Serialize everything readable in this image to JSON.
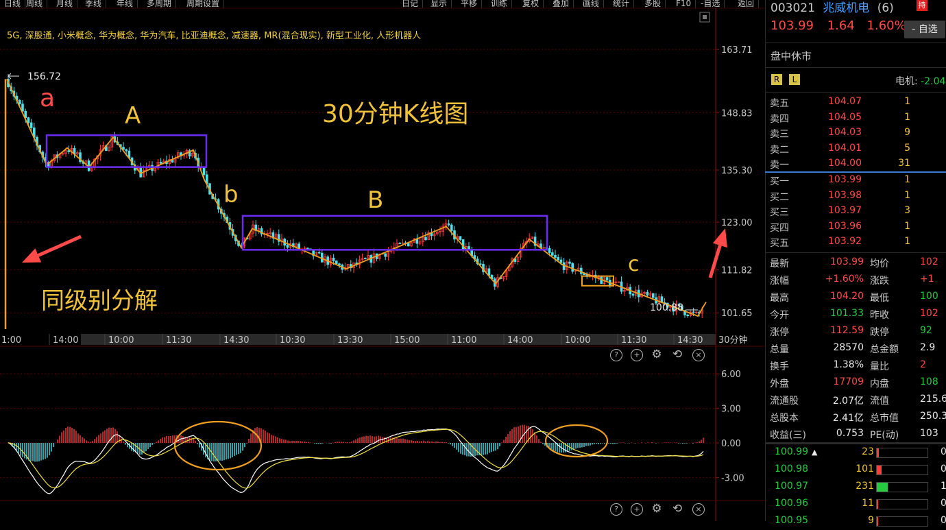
{
  "toolbar": {
    "left_tabs": [
      "日线",
      "周线",
      "月线",
      "季线",
      "年线",
      "多周期",
      "周期设置"
    ],
    "right_tabs": [
      "日记",
      "显示",
      "平移",
      "训练",
      "复权",
      "叠加",
      "画线",
      "统计",
      "多股",
      "F10",
      "-自选",
      "返回"
    ]
  },
  "concepts": "5G, 深股通, 小米概念, 华为概念, 华为汽车, 比亚迪概念, 减速器, MR(混合现实), 新型工业化, 人形机器人",
  "annotations": {
    "title": "30分钟K线图",
    "decompose": "同级别分解",
    "a": "a",
    "A": "A",
    "b": "b",
    "B": "B",
    "c": "c",
    "high_label": "156.72",
    "low_label": "100.88"
  },
  "colors": {
    "up": "#ff3b3b",
    "down": "#4fe0ea",
    "wave": "#f0a020",
    "box": "#6a2cf0",
    "annotation": "#f0c23a",
    "arrow": "#ff4a4a",
    "macd_fast": "#ffffff",
    "macd_slow": "#f0e040"
  },
  "chart_data": [
    {
      "type": "candlestick",
      "title": "30分钟K线图",
      "period_label": "30分钟",
      "y_ticks": [
        163.71,
        148.83,
        135.3,
        123.0,
        111.82,
        101.65
      ],
      "ylim": [
        97.0,
        166.0
      ],
      "x_ticks": [
        "1:00",
        "14:00",
        "10:00",
        "11:30",
        "14:30",
        "10:30",
        "13:30",
        "15:00",
        "11:00",
        "14:00",
        "10:00",
        "11:30",
        "14:30"
      ],
      "annotated_high": 156.72,
      "annotated_low": 100.88,
      "waves": [
        {
          "label": "a",
          "from": 156.72,
          "to": 136.0
        },
        {
          "label": "A",
          "range": [
            136.0,
            143.5
          ]
        },
        {
          "label": "b",
          "from": 142.0,
          "to": 116.5
        },
        {
          "label": "B",
          "range": [
            116.5,
            124.5
          ]
        },
        {
          "label": "c",
          "from": 124.0,
          "to": 100.88
        }
      ],
      "last_close": 103.99
    },
    {
      "type": "line",
      "name": "MACD",
      "y_ticks": [
        6.0,
        3.0,
        0.0,
        -3.0
      ],
      "ylim": [
        -5.0,
        7.5
      ]
    }
  ],
  "panel_icons": [
    "help-icon",
    "zoom-in-icon",
    "settings-icon",
    "refresh-icon",
    "close-icon"
  ],
  "quote": {
    "code": "003021",
    "name": "兆威机电",
    "count": "(6)",
    "badge": "持",
    "price": "103.99",
    "change": "1.64",
    "pct": "1.60%",
    "add_button": "- 自选",
    "status": "盘中休市",
    "rl": [
      "R",
      "L"
    ],
    "sector_label": "电机:",
    "sector_value": "-2.04",
    "asks": [
      {
        "label": "卖五",
        "price": "104.07",
        "vol": "1"
      },
      {
        "label": "卖四",
        "price": "104.05",
        "vol": "1"
      },
      {
        "label": "卖三",
        "price": "104.03",
        "vol": "9"
      },
      {
        "label": "卖二",
        "price": "104.01",
        "vol": "5"
      },
      {
        "label": "卖一",
        "price": "104.00",
        "vol": "31"
      }
    ],
    "bids": [
      {
        "label": "买一",
        "price": "103.99",
        "vol": "1"
      },
      {
        "label": "买二",
        "price": "103.98",
        "vol": "1"
      },
      {
        "label": "买三",
        "price": "103.97",
        "vol": "3"
      },
      {
        "label": "买四",
        "price": "103.96",
        "vol": "1"
      },
      {
        "label": "买五",
        "price": "103.92",
        "vol": "1"
      }
    ],
    "stats": [
      {
        "l1": "最新",
        "v1": "103.99",
        "c1": "red",
        "l2": "均价",
        "v2": "102"
      },
      {
        "l1": "涨幅",
        "v1": "+1.60%",
        "c1": "red",
        "l2": "涨跌",
        "v2": "+1"
      },
      {
        "l1": "最高",
        "v1": "104.20",
        "c1": "red",
        "l2": "最低",
        "v2": "100"
      },
      {
        "l1": "今开",
        "v1": "101.33",
        "c1": "green",
        "l2": "昨收",
        "v2": "102"
      },
      {
        "l1": "涨停",
        "v1": "112.59",
        "c1": "red",
        "l2": "跌停",
        "v2": "92"
      },
      {
        "l1": "总量",
        "v1": "28570",
        "c1": "white",
        "l2": "总金额",
        "v2": "2.9"
      },
      {
        "l1": "换手",
        "v1": "1.38%",
        "c1": "white",
        "l2": "量比",
        "v2": "2"
      },
      {
        "l1": "外盘",
        "v1": "17709",
        "c1": "red",
        "l2": "内盘",
        "v2": "108"
      },
      {
        "l1": "流通股",
        "v1": "2.07亿",
        "c1": "white",
        "l2": "流值",
        "v2": "215.6"
      },
      {
        "l1": "总股本",
        "v1": "2.41亿",
        "c1": "white",
        "l2": "总市值",
        "v2": "250.3"
      },
      {
        "l1": "收益(三)",
        "v1": "0.753",
        "c1": "white",
        "l2": "PE(动)",
        "v2": "103"
      }
    ],
    "ticks": [
      {
        "price": "100.99",
        "arrow": "▲",
        "vol": "23",
        "fill": 0.04,
        "extra": "0"
      },
      {
        "price": "100.98",
        "arrow": "",
        "vol": "101",
        "fill": 0.1,
        "extra": "0"
      },
      {
        "price": "100.97",
        "arrow": "",
        "vol": "231",
        "fill": 0.22,
        "extra": "1"
      },
      {
        "price": "100.96",
        "arrow": "",
        "vol": "11",
        "fill": 0.02,
        "extra": "0"
      },
      {
        "price": "100.95",
        "arrow": "",
        "vol": "9",
        "fill": 0.02,
        "extra": "0"
      }
    ]
  }
}
